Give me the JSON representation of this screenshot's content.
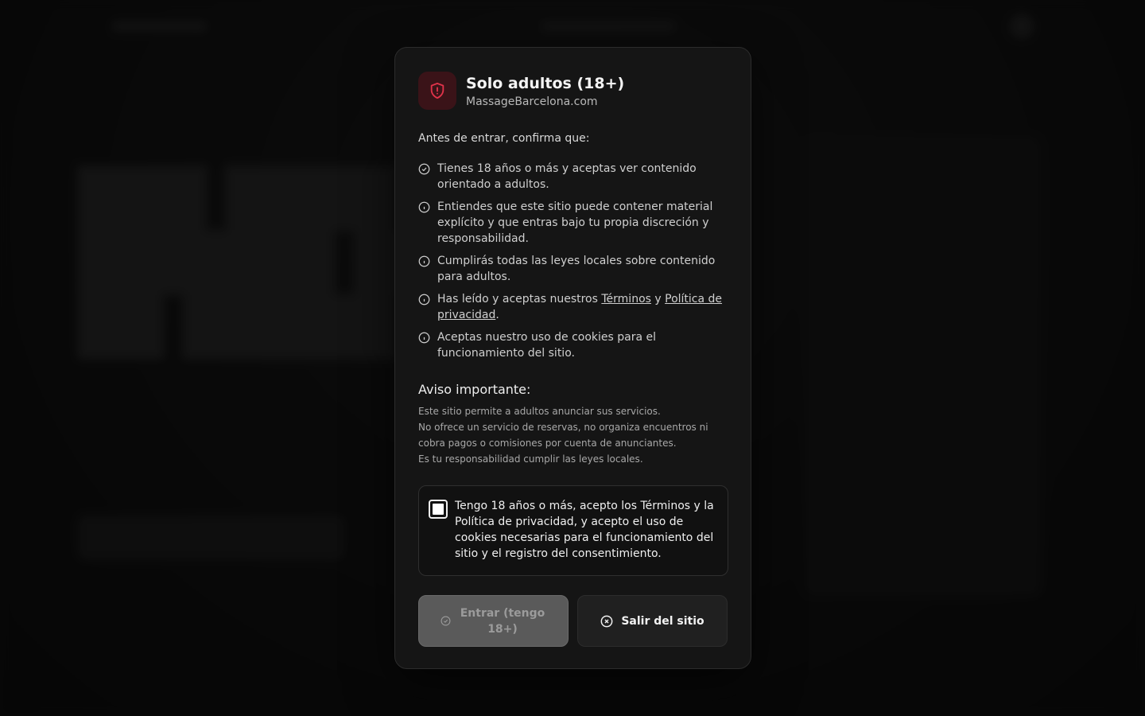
{
  "modal": {
    "title": "Solo adultos (18+)",
    "domain": "MassageBarcelona.com",
    "intro": "Antes de entrar, confirma que:",
    "items": [
      {
        "icon": "check-circle-icon",
        "text": "Tienes 18 años o más y aceptas ver contenido orientado a adultos."
      },
      {
        "icon": "info-circle-icon",
        "text": "Entiendes que este sitio puede contener material explícito y que entras bajo tu propia discreción y responsabilidad."
      },
      {
        "icon": "info-circle-icon",
        "text": "Cumplirás todas las leyes locales sobre contenido para adultos."
      },
      {
        "icon": "info-circle-icon",
        "prefix": "Has leído y aceptas nuestros ",
        "terms_link": "Términos",
        "conjunction": " y ",
        "privacy_link": "Política de privacidad",
        "suffix": "."
      },
      {
        "icon": "info-circle-icon",
        "text": "Aceptas nuestro uso de cookies para el funcionamiento del sitio."
      }
    ],
    "notice_title": "Aviso importante:",
    "notice_lines": [
      "Este sitio permite a adultos anunciar sus servicios.",
      "No ofrece un servicio de reservas, no organiza encuentros ni cobra pagos o comisiones por cuenta de anunciantes.",
      "Es tu responsabilidad cumplir las leyes locales."
    ],
    "consent_text": "Tengo 18 años o más, acepto los Términos y la Política de privacidad, y acepto el uso de cookies necesarias para el funcionamiento del sitio y el registro del consentimiento.",
    "consent_checked": false,
    "enter_label": "Entrar (tengo 18+)",
    "exit_label": "Salir del sitio"
  },
  "colors": {
    "accent_red": "#e0334a",
    "shield_bg": "#3a1318",
    "modal_bg": "#151515"
  }
}
